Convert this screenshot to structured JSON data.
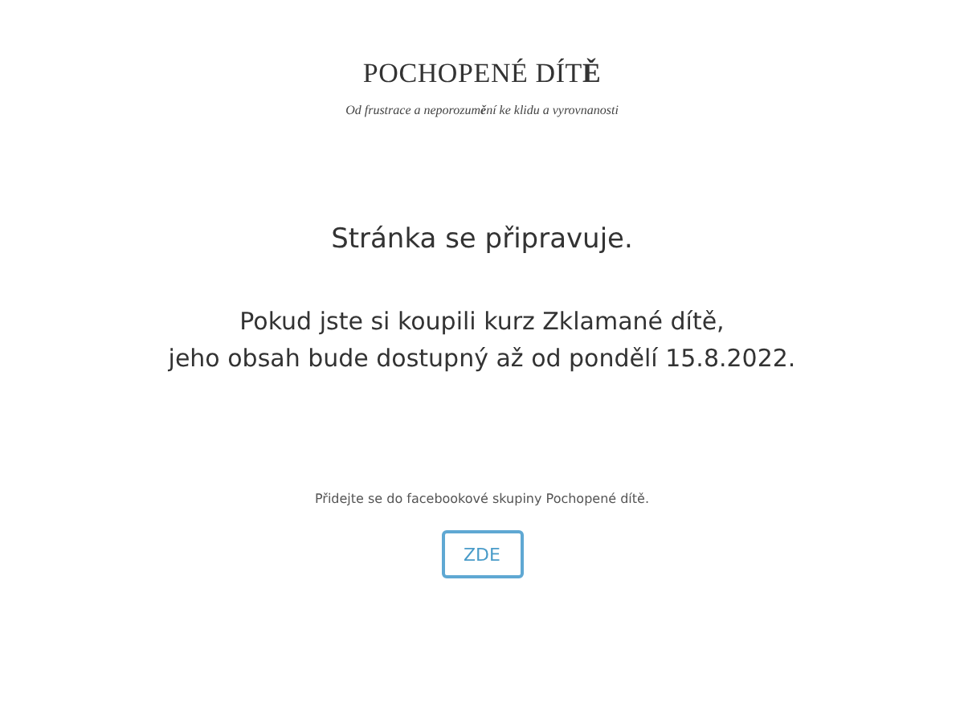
{
  "logo": {
    "title": "POCHOPENÉ DÍT**Ě**",
    "tagline": "Od frustrace a neporozum**ě**ní ke klidu a vyrovnanosti"
  },
  "heading": "Stránka se připravuje.",
  "message": [
    "Pokud jste si koupili kurz Zklamané dítě,",
    "jeho obsah bude dostupný až od pondělí 15.8.2022."
  ],
  "invite": "Přidejte se do facebookové skupiny Pochopené dítě.",
  "button": "ZDE"
}
